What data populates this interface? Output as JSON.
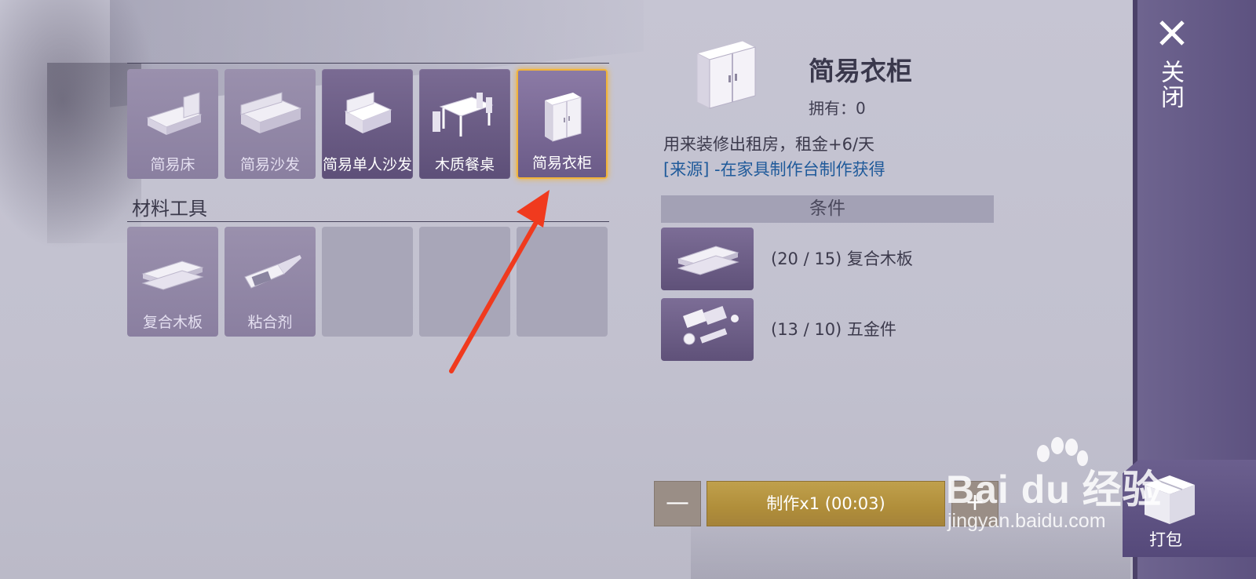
{
  "furniture": [
    {
      "label": "简易床",
      "icon": "bed-icon",
      "state": "faded"
    },
    {
      "label": "简易沙发",
      "icon": "sofa-icon",
      "state": "faded"
    },
    {
      "label": "简易单人沙发",
      "icon": "armchair-icon",
      "state": "owned"
    },
    {
      "label": "木质餐桌",
      "icon": "dining-table-icon",
      "state": "owned"
    },
    {
      "label": "简易衣柜",
      "icon": "wardrobe-icon",
      "state": "selected"
    }
  ],
  "materials": {
    "title": "材料工具",
    "items": [
      {
        "label": "复合木板",
        "icon": "plank-icon"
      },
      {
        "label": "粘合剂",
        "icon": "glue-icon"
      }
    ]
  },
  "detail": {
    "name": "简易衣柜",
    "owned": "拥有：0",
    "description": "用来装修出租房，租金+6/天",
    "source": "[来源] -在家具制作台制作获得",
    "conditions_title": "条件",
    "conditions": [
      {
        "text": "(20 / 15) 复合木板",
        "icon": "plank-icon"
      },
      {
        "text": "(13 / 10) 五金件",
        "icon": "hardware-icon"
      }
    ]
  },
  "actions": {
    "minus": "—",
    "make": "制作x1 (00:03)",
    "plus": "+",
    "close": "关闭",
    "pack": "打包"
  },
  "watermark": {
    "main": "Bai du 经验",
    "sub": "jingyan.baidu.com"
  },
  "colors": {
    "selected_border": "#f2b43a",
    "make_button": "#b6943f",
    "source_link": "#1f5a9a",
    "side_panel": "#665b88",
    "arrow": "#f03a1e"
  }
}
